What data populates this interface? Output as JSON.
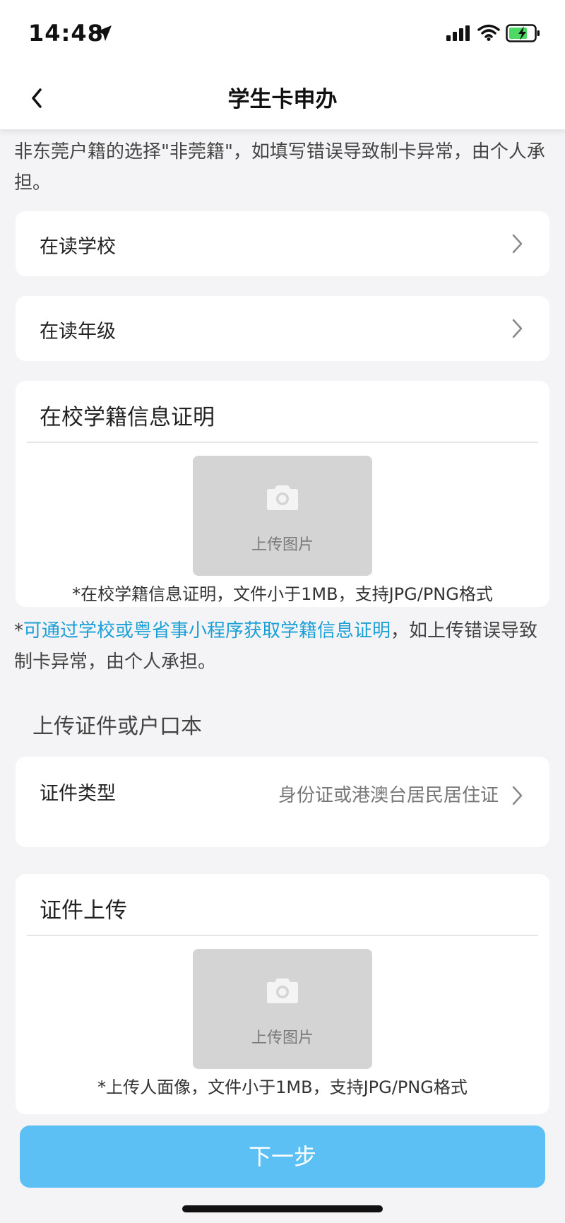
{
  "status": {
    "time": "14:48"
  },
  "nav": {
    "title": "学生卡申办"
  },
  "notice": {
    "text": "非东莞户籍的选择\"非莞籍\"，如填写错误导致制卡异常，由个人承担。"
  },
  "school_row": {
    "label": "在读学校"
  },
  "grade_row": {
    "label": "在读年级"
  },
  "enrollment": {
    "title": "在校学籍信息证明",
    "upload_label": "上传图片",
    "hint": "*在校学籍信息证明，文件小于1MB，支持JPG/PNG格式"
  },
  "info": {
    "prefix": "*",
    "link": "可通过学校或粤省事小程序获取学籍信息证明",
    "rest": "，如上传错误导致制卡异常，由个人承担。"
  },
  "id_section": {
    "title": "上传证件或户口本"
  },
  "id_type": {
    "label": "证件类型",
    "value": "身份证或港澳台居民居住证"
  },
  "id_upload": {
    "title": "证件上传",
    "upload_label": "上传图片",
    "hint": "*上传人面像，文件小于1MB，支持JPG/PNG格式"
  },
  "footer": {
    "next_label": "下一步"
  },
  "colors": {
    "accent": "#5cc0f5",
    "link": "#1aa0d6",
    "battery": "#4cd964"
  }
}
